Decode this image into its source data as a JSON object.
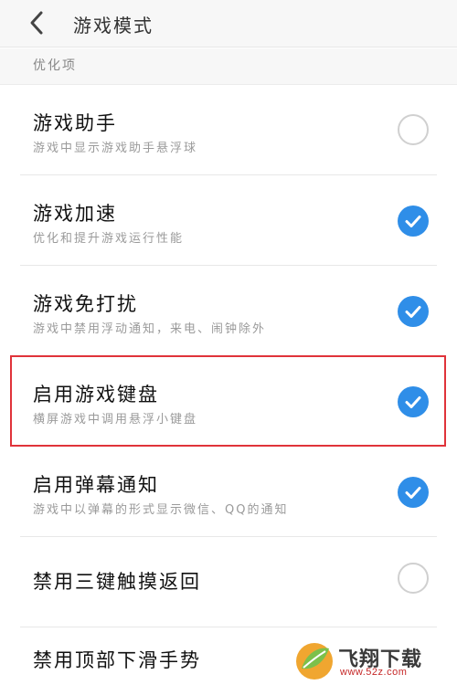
{
  "header": {
    "title": "游戏模式",
    "back_icon": "chevron-left-icon"
  },
  "section": {
    "label": "优化项"
  },
  "settings": [
    {
      "title": "游戏助手",
      "subtitle": "游戏中显示游戏助手悬浮球",
      "checked": false
    },
    {
      "title": "游戏加速",
      "subtitle": "优化和提升游戏运行性能",
      "checked": true
    },
    {
      "title": "游戏免打扰",
      "subtitle": "游戏中禁用浮动通知，来电、闹钟除外",
      "checked": true
    },
    {
      "title": "启用游戏键盘",
      "subtitle": "横屏游戏中调用悬浮小键盘",
      "checked": true,
      "highlighted": true
    },
    {
      "title": "启用弹幕通知",
      "subtitle": "游戏中以弹幕的形式显示微信、QQ的通知",
      "checked": true
    },
    {
      "title": "禁用三键触摸返回",
      "subtitle": "",
      "checked": false
    },
    {
      "title": "禁用顶部下滑手势",
      "subtitle": "",
      "checked": false
    }
  ],
  "colors": {
    "accent": "#2f8ee8",
    "highlight": "#e0333a",
    "unchecked_border": "#d0d0d0"
  },
  "watermark": {
    "name": "飞翔下载",
    "url": "www.52z.com"
  }
}
